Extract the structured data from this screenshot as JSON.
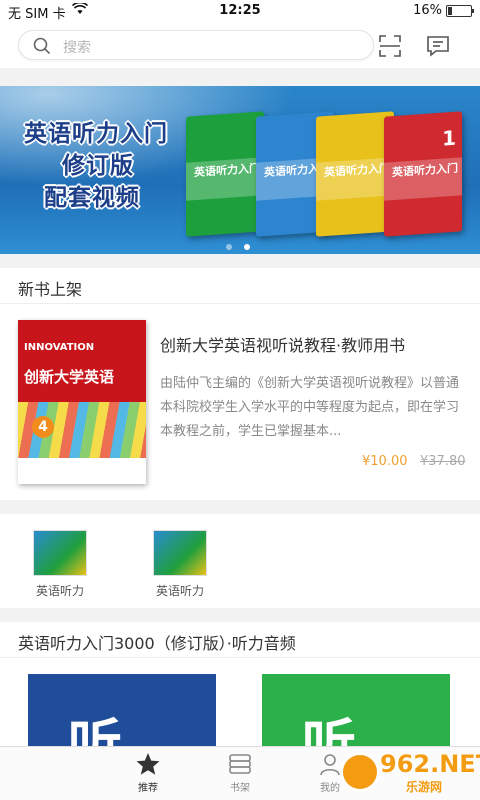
{
  "status_bar": {
    "carrier": "无 SIM 卡",
    "time": "12:25",
    "battery": "16%",
    "battery_level": 0.16
  },
  "header": {
    "search_placeholder": "搜索"
  },
  "banner": {
    "lines": [
      "英语听力入门",
      "修订版",
      "配套视频"
    ],
    "book_title": "英语听力入门",
    "book_number": "1",
    "page_count": 2,
    "active_page": 2
  },
  "new_books": {
    "section_title": "新书上架",
    "book": {
      "title": "创新大学英语视听说教程·教师用书",
      "description": "由陆仲飞主编的《创新大学英语视听说教程》以普通本科院校学生入学水平的中等程度为起点，即在学习本教程之前，学生已掌握基本...",
      "price": "¥10.00",
      "original_price": "¥37.80",
      "cover_text": "INNOVATION",
      "cover_title": "创新大学英语",
      "cover_number": "4"
    }
  },
  "categories": [
    {
      "label": "英语听力"
    },
    {
      "label": "英语听力"
    }
  ],
  "audio": {
    "section_title": "英语听力入门3000（修订版）·听力音频",
    "tile_glyph": "听"
  },
  "tabbar": {
    "items": [
      {
        "label": "推荐",
        "icon": "star-icon",
        "active": true
      },
      {
        "label": "书架",
        "icon": "bookshelf-icon"
      },
      {
        "label": "我的",
        "icon": "user-icon"
      }
    ]
  },
  "watermark": {
    "text": "962.NET",
    "sub": "乐游网"
  }
}
